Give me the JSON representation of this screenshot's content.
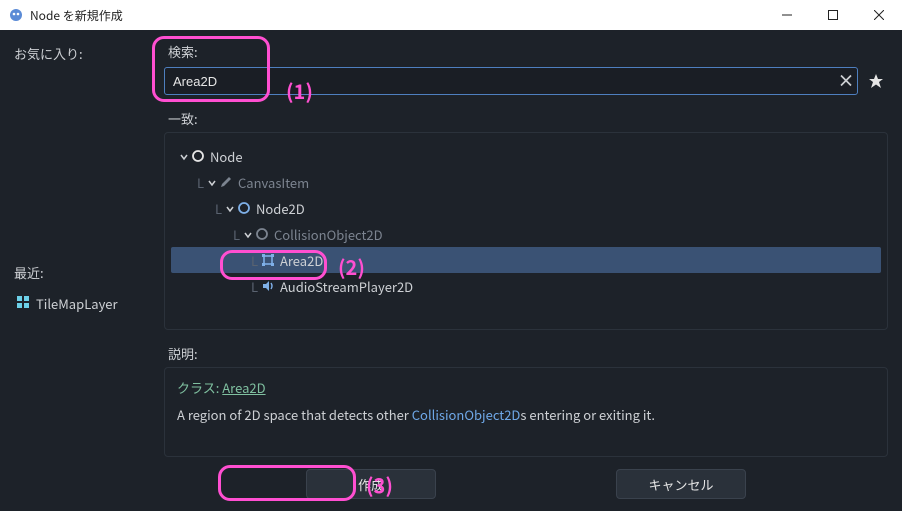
{
  "window": {
    "title": "Node を新規作成"
  },
  "left": {
    "favorites_label": "お気に入り:",
    "recent_label": "最近:",
    "recent": [
      {
        "icon": "tilemap",
        "label": "TileMapLayer"
      }
    ]
  },
  "search": {
    "label": "検索:",
    "value": "Area2D"
  },
  "tree": {
    "label": "一致:",
    "nodes": [
      {
        "indent": 0,
        "icon": "circle-open",
        "label": "Node",
        "dim": false,
        "chev": true
      },
      {
        "indent": 1,
        "icon": "pencil",
        "label": "CanvasItem",
        "dim": true,
        "chev": true
      },
      {
        "indent": 2,
        "icon": "circle-blue",
        "label": "Node2D",
        "dim": false,
        "chev": true
      },
      {
        "indent": 3,
        "icon": "circle-open-dim",
        "label": "CollisionObject2D",
        "dim": true,
        "chev": true
      },
      {
        "indent": 4,
        "icon": "area2d",
        "label": "Area2D",
        "dim": false,
        "chev": false,
        "selected": true
      },
      {
        "indent": 4,
        "icon": "audio",
        "label": "AudioStreamPlayer2D",
        "dim": false,
        "chev": false
      }
    ]
  },
  "desc": {
    "label": "説明:",
    "class_prefix": "クラス: ",
    "class_name": "Area2D",
    "text_pre": "A region of 2D space that detects other ",
    "text_code": "CollisionObject2D",
    "text_post": "s entering or exiting it."
  },
  "buttons": {
    "create": "作成",
    "cancel": "キャンセル"
  },
  "annotations": {
    "n1": "(1)",
    "n2": "(2)",
    "n3": "(3)"
  }
}
